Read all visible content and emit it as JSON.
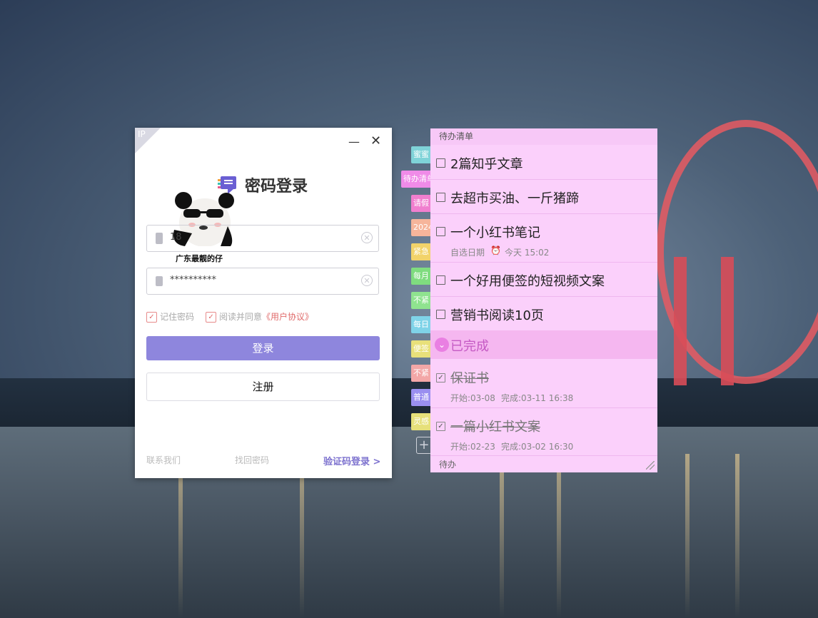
{
  "login": {
    "corner_tag": "IP",
    "minimize_glyph": "—",
    "close_glyph": "✕",
    "title": "密码登录",
    "sticker_caption": "广东最靓的仔",
    "account_value": "18",
    "password_value": "**********",
    "remember_label": "记住密码",
    "agree_label": "阅读并同意",
    "agreement_link": "《用户协议》",
    "login_button": "登录",
    "register_button": "注册",
    "contact_link": "联系我们",
    "forgot_link": "找回密码",
    "code_login_link": "验证码登录 >",
    "accent_color": "#8e86dd"
  },
  "side_tags": [
    {
      "text": "蜜蜜",
      "color": "#7fd3d8"
    },
    {
      "text": "待办清单",
      "color": "#f08be8"
    },
    {
      "text": "请假",
      "color": "#f07fcf"
    },
    {
      "text": "2024",
      "color": "#f6b59b"
    },
    {
      "text": "紧急",
      "color": "#f2d36a"
    },
    {
      "text": "每月",
      "color": "#7fdc7f"
    },
    {
      "text": "不紧",
      "color": "#8fe38f"
    },
    {
      "text": "每日",
      "color": "#7fd3e8"
    },
    {
      "text": "便签",
      "color": "#e8e07a"
    },
    {
      "text": "不紧",
      "color": "#f3a7a7"
    },
    {
      "text": "普通",
      "color": "#9a8ff0"
    },
    {
      "text": "灵感",
      "color": "#e6e07a"
    }
  ],
  "plus_tab": "+",
  "todo": {
    "header": "待办清单",
    "items": [
      {
        "text": "2篇知乎文章"
      },
      {
        "text": "去超市买油、一斤猪蹄"
      },
      {
        "text": "一个小红书笔记",
        "date_label": "自选日期",
        "alarm": "今天 15:02"
      },
      {
        "text": "一个好用便签的短视频文案"
      },
      {
        "text": "营销书阅读10页"
      }
    ],
    "completed_label": "已完成",
    "completed_items": [
      {
        "text": "保证书",
        "start": "开始:03-08",
        "finish": "完成:03-11 16:38"
      },
      {
        "text": "一篇小红书文案",
        "start": "开始:02-23",
        "finish": "完成:03-02 16:30"
      }
    ],
    "footer": "待办",
    "background_color": "#fbd0fb"
  }
}
